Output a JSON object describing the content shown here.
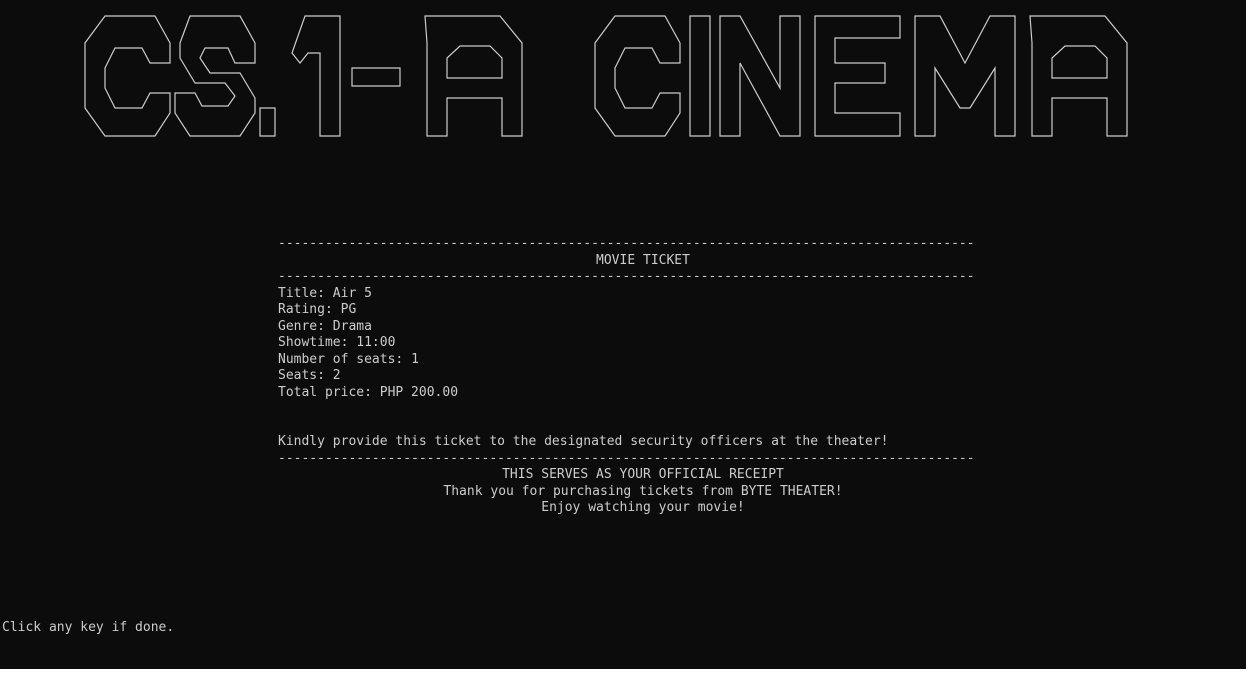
{
  "banner": {
    "text": "CS1-A CINEMA"
  },
  "receipt": {
    "rule": "-----------------------------------------------------------------------------------------",
    "header": "MOVIE TICKET",
    "fields": [
      {
        "label": "Title",
        "value": "Air 5"
      },
      {
        "label": "Rating",
        "value": "PG"
      },
      {
        "label": "Genre",
        "value": "Drama"
      },
      {
        "label": "Showtime",
        "value": "11:00"
      },
      {
        "label": "Number of seats",
        "value": "1"
      },
      {
        "label": "Seats",
        "value": "2"
      },
      {
        "label": "Total price",
        "value": "PHP 200.00"
      }
    ],
    "notice": "Kindly provide this ticket to the designated security officers at the theater!",
    "footer": [
      "THIS SERVES AS YOUR OFFICIAL RECEIPT",
      "Thank you for purchasing tickets from BYTE THEATER!",
      "Enjoy watching your movie!"
    ]
  },
  "prompt": "Click any key if done.",
  "colors": {
    "background": "#0c0c0c",
    "text": "#cccccc"
  }
}
